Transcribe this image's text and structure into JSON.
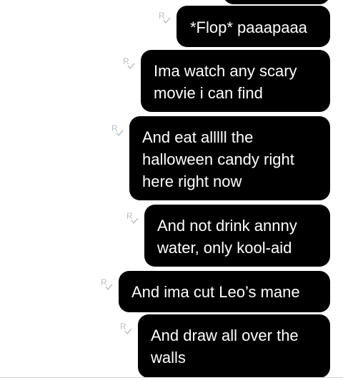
{
  "conversation": {
    "messages": [
      {
        "text": "",
        "read_marker": ""
      },
      {
        "text": "*Flop* paaapaaa",
        "read_marker": "R"
      },
      {
        "text": "Ima watch any scary\nmovie i can find",
        "read_marker": "R"
      },
      {
        "text": "And eat alllll the\nhalloween candy right\nhere right now",
        "read_marker": "R"
      },
      {
        "text": "And not drink annny\nwater, only kool-aid",
        "read_marker": "R"
      },
      {
        "text": "And ima cut Leo’s mane",
        "read_marker": "R"
      },
      {
        "text": "And draw all over the\nwalls",
        "read_marker": "R"
      }
    ]
  },
  "colors": {
    "bubble_background": "#000000",
    "bubble_text": "#ffffff",
    "read_receipt": "#b9bfc9",
    "background": "#ffffff"
  },
  "icons": {
    "read_receipt": "read-receipt-icon"
  }
}
